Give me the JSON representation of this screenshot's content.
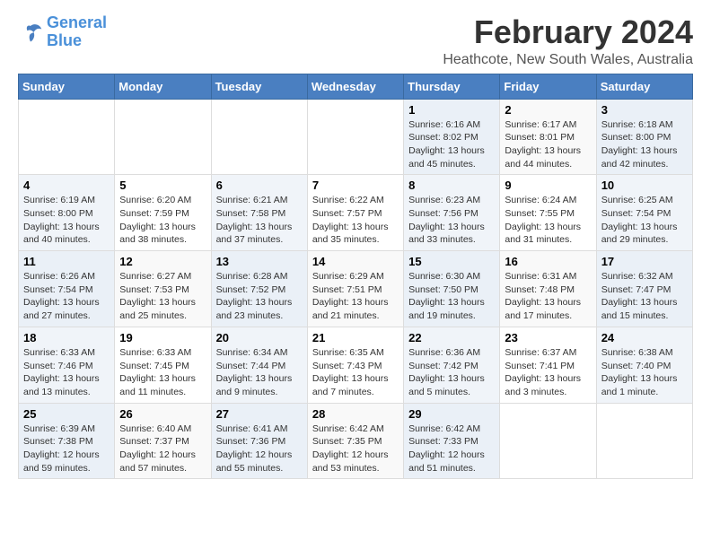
{
  "header": {
    "logo_line1": "General",
    "logo_line2": "Blue",
    "title": "February 2024",
    "subtitle": "Heathcote, New South Wales, Australia"
  },
  "weekdays": [
    "Sunday",
    "Monday",
    "Tuesday",
    "Wednesday",
    "Thursday",
    "Friday",
    "Saturday"
  ],
  "weeks": [
    [
      {
        "day": "",
        "info": ""
      },
      {
        "day": "",
        "info": ""
      },
      {
        "day": "",
        "info": ""
      },
      {
        "day": "",
        "info": ""
      },
      {
        "day": "1",
        "info": "Sunrise: 6:16 AM\nSunset: 8:02 PM\nDaylight: 13 hours\nand 45 minutes."
      },
      {
        "day": "2",
        "info": "Sunrise: 6:17 AM\nSunset: 8:01 PM\nDaylight: 13 hours\nand 44 minutes."
      },
      {
        "day": "3",
        "info": "Sunrise: 6:18 AM\nSunset: 8:00 PM\nDaylight: 13 hours\nand 42 minutes."
      }
    ],
    [
      {
        "day": "4",
        "info": "Sunrise: 6:19 AM\nSunset: 8:00 PM\nDaylight: 13 hours\nand 40 minutes."
      },
      {
        "day": "5",
        "info": "Sunrise: 6:20 AM\nSunset: 7:59 PM\nDaylight: 13 hours\nand 38 minutes."
      },
      {
        "day": "6",
        "info": "Sunrise: 6:21 AM\nSunset: 7:58 PM\nDaylight: 13 hours\nand 37 minutes."
      },
      {
        "day": "7",
        "info": "Sunrise: 6:22 AM\nSunset: 7:57 PM\nDaylight: 13 hours\nand 35 minutes."
      },
      {
        "day": "8",
        "info": "Sunrise: 6:23 AM\nSunset: 7:56 PM\nDaylight: 13 hours\nand 33 minutes."
      },
      {
        "day": "9",
        "info": "Sunrise: 6:24 AM\nSunset: 7:55 PM\nDaylight: 13 hours\nand 31 minutes."
      },
      {
        "day": "10",
        "info": "Sunrise: 6:25 AM\nSunset: 7:54 PM\nDaylight: 13 hours\nand 29 minutes."
      }
    ],
    [
      {
        "day": "11",
        "info": "Sunrise: 6:26 AM\nSunset: 7:54 PM\nDaylight: 13 hours\nand 27 minutes."
      },
      {
        "day": "12",
        "info": "Sunrise: 6:27 AM\nSunset: 7:53 PM\nDaylight: 13 hours\nand 25 minutes."
      },
      {
        "day": "13",
        "info": "Sunrise: 6:28 AM\nSunset: 7:52 PM\nDaylight: 13 hours\nand 23 minutes."
      },
      {
        "day": "14",
        "info": "Sunrise: 6:29 AM\nSunset: 7:51 PM\nDaylight: 13 hours\nand 21 minutes."
      },
      {
        "day": "15",
        "info": "Sunrise: 6:30 AM\nSunset: 7:50 PM\nDaylight: 13 hours\nand 19 minutes."
      },
      {
        "day": "16",
        "info": "Sunrise: 6:31 AM\nSunset: 7:48 PM\nDaylight: 13 hours\nand 17 minutes."
      },
      {
        "day": "17",
        "info": "Sunrise: 6:32 AM\nSunset: 7:47 PM\nDaylight: 13 hours\nand 15 minutes."
      }
    ],
    [
      {
        "day": "18",
        "info": "Sunrise: 6:33 AM\nSunset: 7:46 PM\nDaylight: 13 hours\nand 13 minutes."
      },
      {
        "day": "19",
        "info": "Sunrise: 6:33 AM\nSunset: 7:45 PM\nDaylight: 13 hours\nand 11 minutes."
      },
      {
        "day": "20",
        "info": "Sunrise: 6:34 AM\nSunset: 7:44 PM\nDaylight: 13 hours\nand 9 minutes."
      },
      {
        "day": "21",
        "info": "Sunrise: 6:35 AM\nSunset: 7:43 PM\nDaylight: 13 hours\nand 7 minutes."
      },
      {
        "day": "22",
        "info": "Sunrise: 6:36 AM\nSunset: 7:42 PM\nDaylight: 13 hours\nand 5 minutes."
      },
      {
        "day": "23",
        "info": "Sunrise: 6:37 AM\nSunset: 7:41 PM\nDaylight: 13 hours\nand 3 minutes."
      },
      {
        "day": "24",
        "info": "Sunrise: 6:38 AM\nSunset: 7:40 PM\nDaylight: 13 hours\nand 1 minute."
      }
    ],
    [
      {
        "day": "25",
        "info": "Sunrise: 6:39 AM\nSunset: 7:38 PM\nDaylight: 12 hours\nand 59 minutes."
      },
      {
        "day": "26",
        "info": "Sunrise: 6:40 AM\nSunset: 7:37 PM\nDaylight: 12 hours\nand 57 minutes."
      },
      {
        "day": "27",
        "info": "Sunrise: 6:41 AM\nSunset: 7:36 PM\nDaylight: 12 hours\nand 55 minutes."
      },
      {
        "day": "28",
        "info": "Sunrise: 6:42 AM\nSunset: 7:35 PM\nDaylight: 12 hours\nand 53 minutes."
      },
      {
        "day": "29",
        "info": "Sunrise: 6:42 AM\nSunset: 7:33 PM\nDaylight: 12 hours\nand 51 minutes."
      },
      {
        "day": "",
        "info": ""
      },
      {
        "day": "",
        "info": ""
      }
    ]
  ]
}
